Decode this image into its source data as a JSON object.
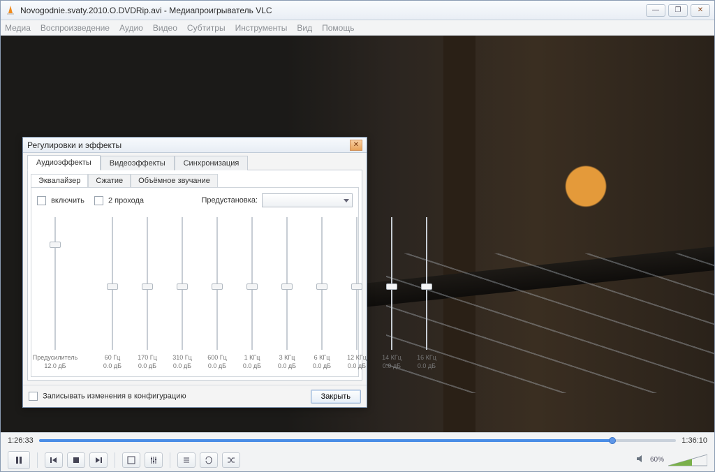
{
  "window": {
    "title": "Novogodnie.svaty.2010.O.DVDRip.avi - Медиапроигрыватель VLC",
    "buttons": {
      "min": "—",
      "max": "❐",
      "close": "✕"
    }
  },
  "menu": [
    "Медиа",
    "Воспроизведение",
    "Аудио",
    "Видео",
    "Субтитры",
    "Инструменты",
    "Вид",
    "Помощь"
  ],
  "playback": {
    "elapsed": "1:26:33",
    "total": "1:36:10",
    "progress_pct": 90,
    "volume_pct": 60,
    "volume_label": "60%"
  },
  "toolbar_icons": [
    "play-pause",
    "prev",
    "stop",
    "next",
    "fullscreen",
    "ext-settings",
    "playlist",
    "loop",
    "shuffle"
  ],
  "dialog": {
    "title": "Регулировки и эффекты",
    "tabs": [
      "Аудиоэффекты",
      "Видеоэффекты",
      "Синхронизация"
    ],
    "active_tab": 0,
    "subtabs": [
      "Эквалайзер",
      "Сжатие",
      "Объёмное звучание"
    ],
    "active_subtab": 0,
    "enable_label": "включить",
    "twopass_label": "2 прохода",
    "preset_label": "Предустановка:",
    "preset_value": "",
    "preamp": {
      "label": "Предусилитель",
      "db_label": "12.0 дБ",
      "pos_pct": 18
    },
    "bands": [
      {
        "freq": "60 Гц",
        "db": "0.0 дБ",
        "pos_pct": 50
      },
      {
        "freq": "170 Гц",
        "db": "0.0 дБ",
        "pos_pct": 50
      },
      {
        "freq": "310 Гц",
        "db": "0.0 дБ",
        "pos_pct": 50
      },
      {
        "freq": "600 Гц",
        "db": "0.0 дБ",
        "pos_pct": 50
      },
      {
        "freq": "1 КГц",
        "db": "0.0 дБ",
        "pos_pct": 50
      },
      {
        "freq": "3 КГц",
        "db": "0.0 дБ",
        "pos_pct": 50
      },
      {
        "freq": "6 КГц",
        "db": "0.0 дБ",
        "pos_pct": 50
      },
      {
        "freq": "12 КГц",
        "db": "0.0 дБ",
        "pos_pct": 50
      },
      {
        "freq": "14 КГц",
        "db": "0.0 дБ",
        "pos_pct": 50
      },
      {
        "freq": "16 КГц",
        "db": "0.0 дБ",
        "pos_pct": 50
      }
    ],
    "save_config_label": "Записывать изменения в конфигурацию",
    "close_label": "Закрыть"
  }
}
